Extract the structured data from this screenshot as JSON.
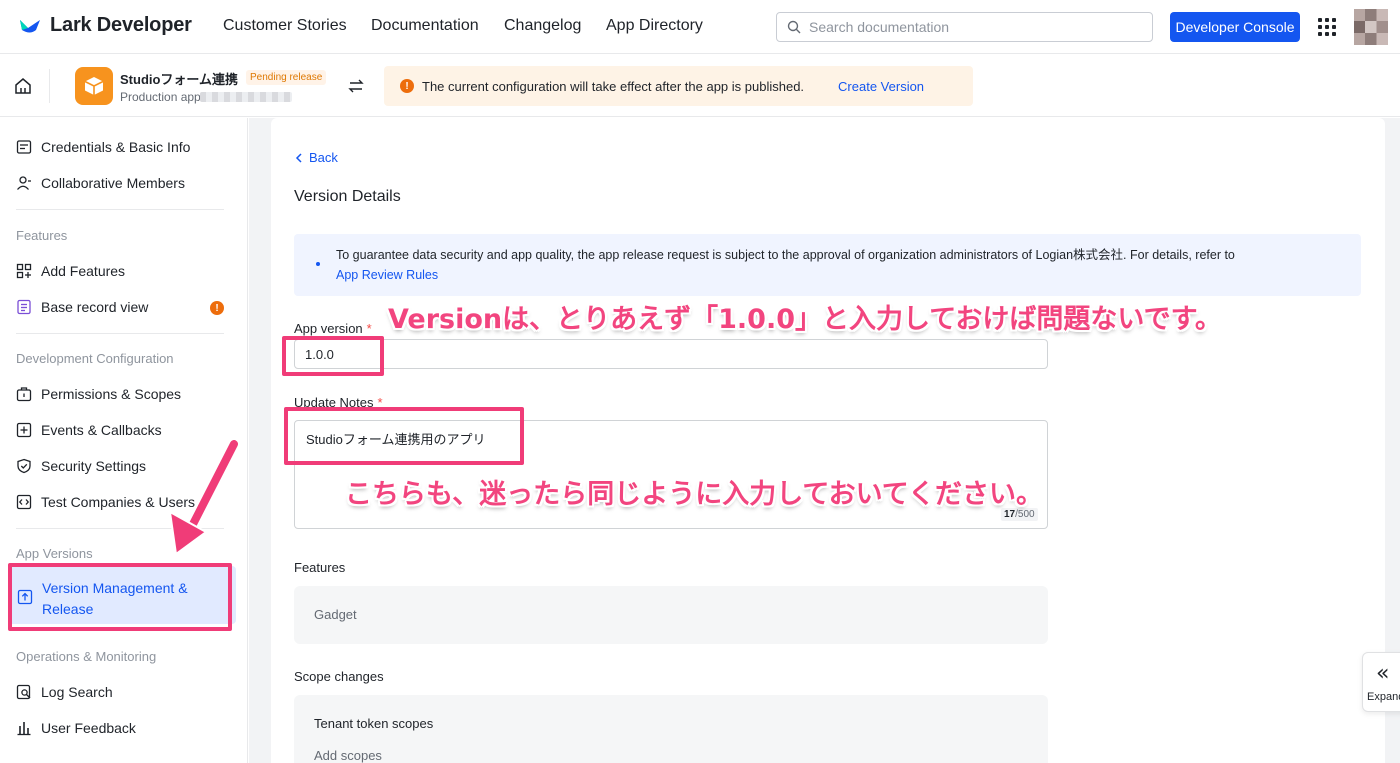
{
  "topnav": {
    "logo_text": "Lark Developer",
    "links": [
      "Customer Stories",
      "Documentation",
      "Changelog",
      "App Directory"
    ],
    "search_placeholder": "Search documentation",
    "console_button": "Developer Console"
  },
  "appbar": {
    "app_name": "Studioフォーム連携",
    "badge": "Pending release",
    "app_sub": "Production app",
    "notice_text": "The current configuration will take effect after the app is published.",
    "notice_link": "Create Version"
  },
  "sidebar": {
    "credentials": "Credentials & Basic Info",
    "members": "Collaborative Members",
    "group_features": "Features",
    "add_features": "Add Features",
    "base_record": "Base record view",
    "group_dev": "Development Configuration",
    "permissions": "Permissions & Scopes",
    "events": "Events & Callbacks",
    "security": "Security Settings",
    "test_companies": "Test Companies & Users",
    "group_versions": "App Versions",
    "version_mgmt": "Version Management & Release",
    "group_ops": "Operations & Monitoring",
    "log_search": "Log Search",
    "user_feedback": "User Feedback"
  },
  "main": {
    "back": "Back",
    "title": "Version Details",
    "info_text": "To guarantee data security and app quality, the app release request is subject to the approval of organization administrators of Logian株式会社. For details, refer to",
    "info_link": "App Review Rules",
    "version_label": "App version",
    "version_value": "1.0.0",
    "notes_label": "Update Notes",
    "notes_value": "Studioフォーム連携用のアプリ",
    "counter_current": "17",
    "counter_max": "/500",
    "features_label": "Features",
    "features_value": "Gadget",
    "scope_label": "Scope changes",
    "tenant_scopes": "Tenant token scopes",
    "add_scopes": "Add scopes",
    "expand_label": "Expand"
  },
  "annotations": {
    "version_note": "Versionは、とりあえず「1.0.0」と入力しておけば問題ないです。",
    "notes_note": "こちらも、迷ったら同じように入力しておいてください。"
  },
  "colors": {
    "primary": "#1456f0",
    "annotation": "#f03c78",
    "warning": "#ed6d0c"
  }
}
